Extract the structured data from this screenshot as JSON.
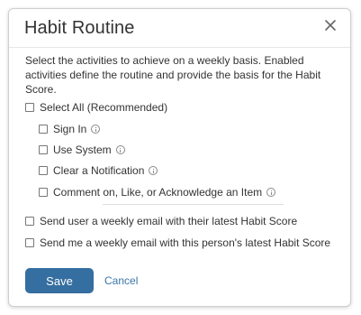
{
  "dialog": {
    "title": "Habit Routine",
    "close_icon": "close-icon",
    "description": "Select the activities to achieve on a weekly basis. Enabled activities define the routine and provide the basis for the Habit Score."
  },
  "options": {
    "select_all": "Select All (Recommended)",
    "activities": [
      {
        "label": "Sign In",
        "info_icon": "info-icon"
      },
      {
        "label": "Use System",
        "info_icon": "info-icon"
      },
      {
        "label": "Clear a Notification",
        "info_icon": "info-icon"
      },
      {
        "label": "Comment on, Like, or Acknowledge an Item",
        "info_icon": "info-icon"
      }
    ],
    "email_user": "Send user a weekly email with their latest Habit Score",
    "email_me": "Send me a weekly email with this person's latest Habit Score"
  },
  "actions": {
    "save_label": "Save",
    "cancel_label": "Cancel"
  },
  "colors": {
    "primary": "#356ea0",
    "link": "#3b75a8"
  }
}
